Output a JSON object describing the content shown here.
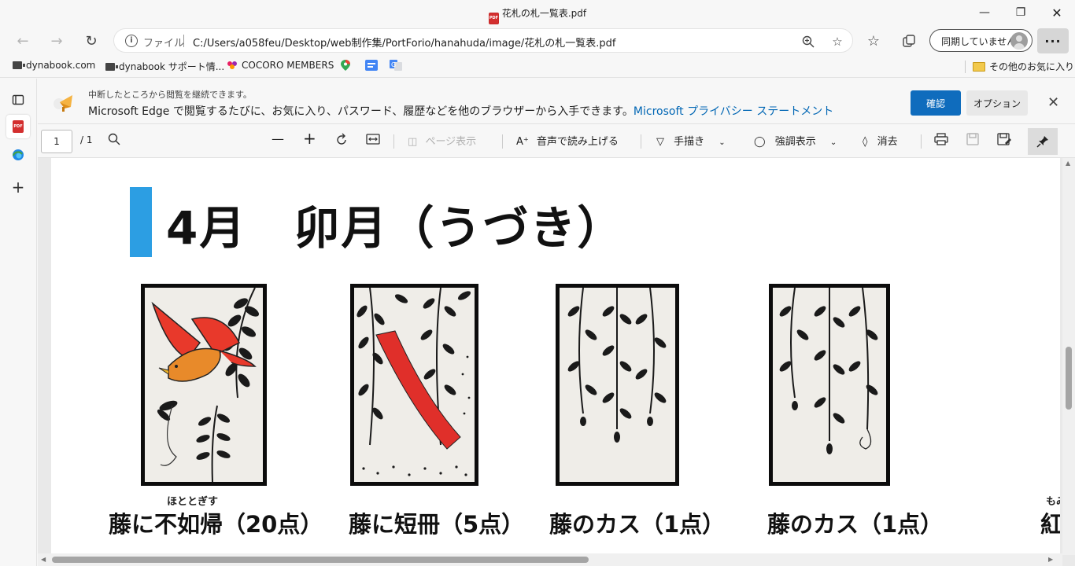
{
  "window": {
    "title": "花札の札一覧表.pdf"
  },
  "nav": {
    "scheme_label": "ファイル",
    "url": "C:/Users/a058feu/Desktop/web制作集/PortForio/hanahuda/image/花札の札一覧表.pdf",
    "profile_label": "同期していません"
  },
  "favorites": [
    {
      "label": "dynabook.com",
      "icon": "dynabook-icon"
    },
    {
      "label": "dynabook サポート情...",
      "icon": "dynabook-icon"
    },
    {
      "label": "COCORO MEMBERS",
      "icon": "cocoro-icon"
    },
    {
      "label": "",
      "icon": "maps-icon"
    },
    {
      "label": "",
      "icon": "google-sites-icon"
    },
    {
      "label": "",
      "icon": "google-translate-icon"
    }
  ],
  "favorites_other": "その他のお気に入り",
  "infobar": {
    "small_text": "中断したところから閲覧を継続できます。",
    "main_text": "Microsoft Edge で閲覧するたびに、お気に入り、パスワード、履歴などを他のブラウザーから入手できます。",
    "link_text": "Microsoft プライバシー ステートメント",
    "confirm_label": "確認",
    "option_label": "オプション"
  },
  "pdf_toolbar": {
    "page_current": "1",
    "page_total": "/ 1",
    "page_view_label": "ページ表示",
    "read_aloud_label": "音声で読み上げる",
    "draw_label": "手描き",
    "highlight_label": "強調表示",
    "erase_label": "消去"
  },
  "document": {
    "heading": "4月　卯月（うづき）",
    "heading_color": "#2c9ee3",
    "cards": [
      {
        "name": "藤に不如帰（20点）",
        "ruby": "ほととぎす"
      },
      {
        "name": "藤に短冊（5点）",
        "ruby": ""
      },
      {
        "name": "藤のカス（1点）",
        "ruby": ""
      },
      {
        "name": "藤のカス（1点）",
        "ruby": ""
      }
    ],
    "cut_caption": "紅",
    "cut_ruby": "もみ"
  }
}
